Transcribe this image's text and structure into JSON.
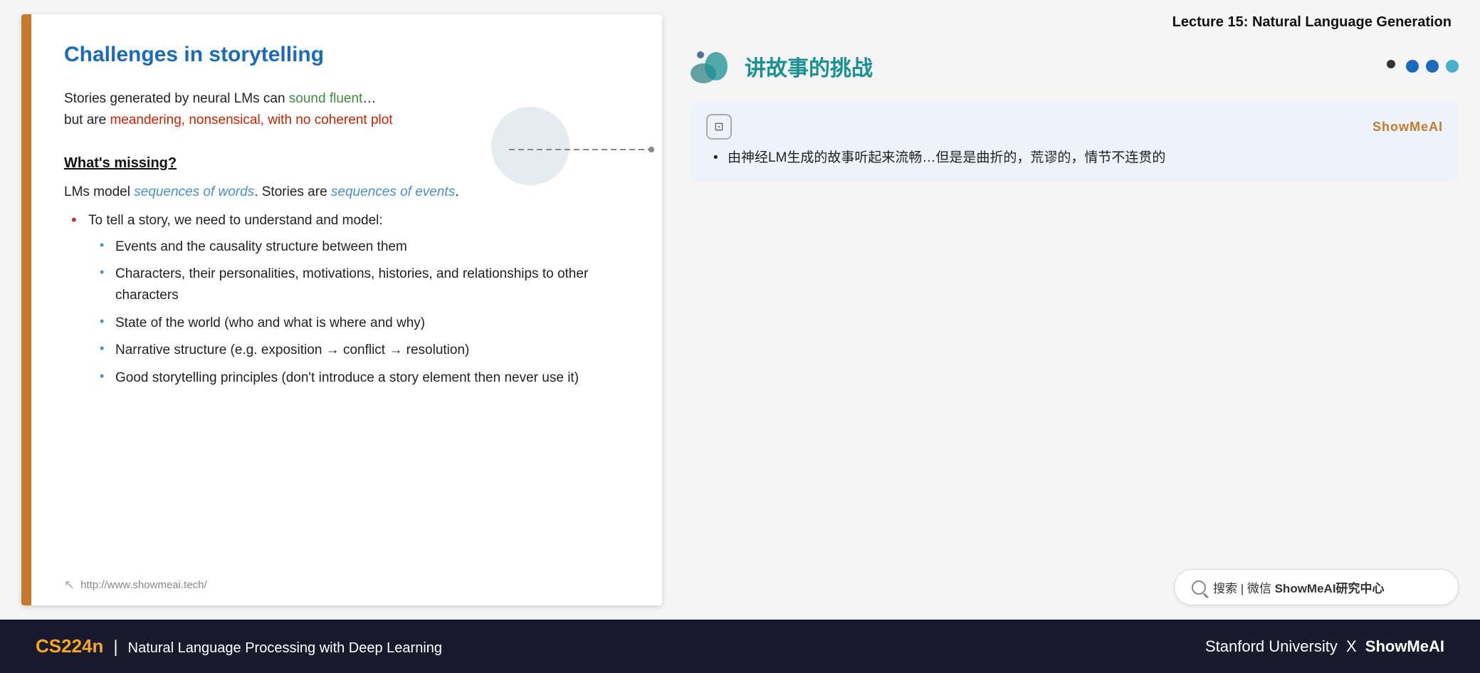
{
  "lecture": {
    "title": "Lecture 15: Natural Language Generation"
  },
  "slide": {
    "title": "Challenges in storytelling",
    "left_bar_color": "#c47a2a",
    "paragraph1_start": "Stories generated by neural LMs can ",
    "paragraph1_green": "sound fluent",
    "paragraph1_ellipsis": "…",
    "paragraph1_line2_start": "but are ",
    "paragraph1_red": "meandering, nonsensical, with no coherent plot",
    "section_heading": "What's missing?",
    "lm_sentence_start": "LMs model ",
    "lm_italic1": "sequences of words",
    "lm_sentence_mid": ". Stories are ",
    "lm_italic2": "sequences of events",
    "lm_sentence_end": ".",
    "main_bullet": "To tell a story, we need to understand and model:",
    "sub_bullets": [
      "Events and the causality structure between them",
      "Characters, their personalities, motivations, histories, and relationships to other characters",
      "State of the world (who and what is where and why)",
      "Narrative structure (e.g. exposition → conflict → resolution)",
      "Good storytelling principles (don't introduce a story element then never use it)"
    ],
    "footer_url": "http://www.showmeai.tech/"
  },
  "right_panel": {
    "chinese_title": "讲故事的挑战",
    "showmeai_label": "ShowMeAI",
    "ai_card_bullet": "由神经LM生成的故事听起来流畅…但是是曲折的，荒谬的，情节不连贯的",
    "search_text": "搜索 | 微信 ",
    "search_bold": "ShowMeAI研究中心"
  },
  "footer": {
    "cs224n": "CS224n",
    "subtitle": "Natural Language Processing with Deep Learning",
    "stanford": "Stanford University",
    "x": "X",
    "showmeai": "ShowMeAI"
  }
}
